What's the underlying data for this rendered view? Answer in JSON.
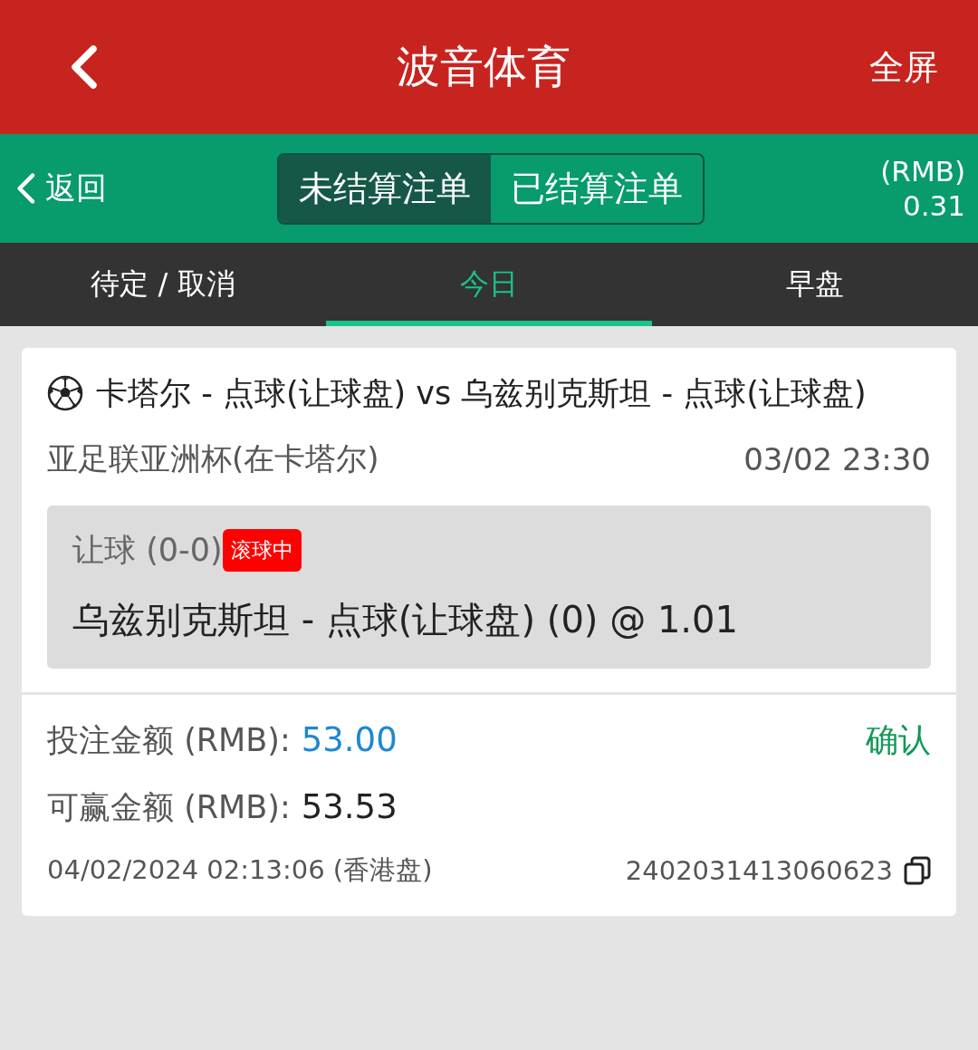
{
  "header": {
    "title": "波音体育",
    "fullscreen": "全屏"
  },
  "subbar": {
    "back_label": "返回",
    "segments": [
      {
        "label": "未结算注单",
        "selected": true
      },
      {
        "label": "已结算注单",
        "selected": false
      }
    ],
    "currency": "(RMB)",
    "balance": "0.31"
  },
  "tabs": [
    {
      "label": "待定 / 取消",
      "selected": false
    },
    {
      "label": "今日",
      "selected": true
    },
    {
      "label": "早盘",
      "selected": false
    }
  ],
  "bet": {
    "match": "卡塔尔 - 点球(让球盘) vs 乌兹别克斯坦 - 点球(让球盘)",
    "league": "亚足联亚洲杯(在卡塔尔)",
    "match_time": "03/02 23:30",
    "market": "让球 (0-0)",
    "live_badge": "滚球中",
    "selection": "乌兹别克斯坦 - 点球(让球盘) (0) @ 1.01",
    "stake_label": "投注金额 (RMB):",
    "stake": "53.00",
    "status": "确认",
    "win_label": "可赢金额 (RMB):",
    "win": "53.53",
    "placed_at": "04/02/2024 02:13:06 (香港盘)",
    "ticket_id": "2402031413060623"
  }
}
